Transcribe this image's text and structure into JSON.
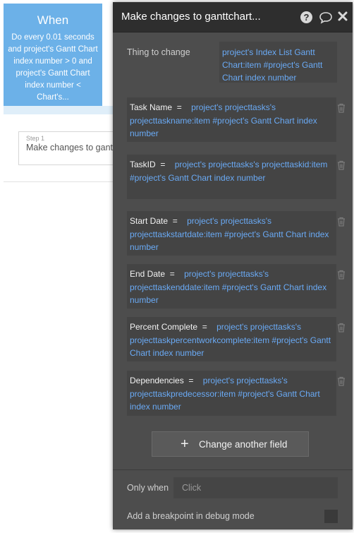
{
  "event": {
    "title": "When",
    "description": "Do every 0.01 seconds and project's Gantt Chart index number > 0 and project's Gantt Chart index number < Chart's..."
  },
  "step": {
    "label": "Step 1",
    "text": "Make changes to ganttchart"
  },
  "panel": {
    "title": "Make changes to ganttchart...",
    "thing_label": "Thing to change",
    "thing_value": "project's Index List Gantt Chart:item #project's Gantt Chart index number",
    "fields": [
      {
        "name": "Task Name",
        "value": "project's projecttasks's projecttaskname:item #project's Gantt Chart index number"
      },
      {
        "name": "TaskID",
        "value": "project's projecttasks's projecttaskid:item #project's Gantt Chart index number"
      },
      {
        "name": "Start Date",
        "value": "project's projecttasks's projecttaskstartdate:item #project's Gantt Chart index number"
      },
      {
        "name": "End Date",
        "value": "project's projecttasks's projecttaskenddate:item #project's Gantt Chart index number"
      },
      {
        "name": "Percent Complete",
        "value": "project's projecttasks's projecttaskpercentworkcomplete:item #project's Gantt Chart index number"
      },
      {
        "name": "Dependencies",
        "value": "project's projecttasks's projecttaskpredecessor:item #project's Gantt Chart index number"
      }
    ],
    "equals": "=",
    "add_button_label": "Change another field",
    "only_when_label": "Only when",
    "only_when_placeholder": "Click",
    "breakpoint_label": "Add a breakpoint in debug mode"
  },
  "icons": {
    "help": "help-icon",
    "comment": "comment-icon",
    "close": "close-icon",
    "trash": "trash-icon",
    "plus": "plus-icon"
  },
  "colors": {
    "panel_bg": "#4d4d4d",
    "header_bg": "#2e2e2e",
    "field_bg": "#444444",
    "expression_blue": "#6aaaf5",
    "event_blue": "#6cb1e8"
  }
}
